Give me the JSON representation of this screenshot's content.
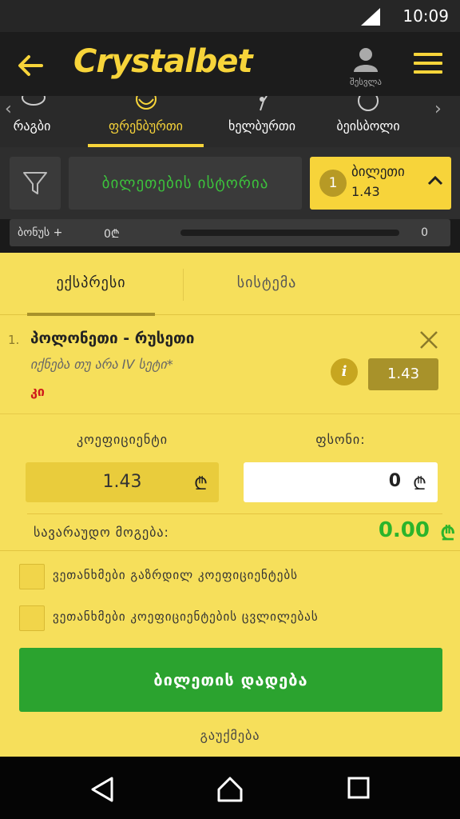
{
  "status_bar": {
    "time": "10:09"
  },
  "header": {
    "logo": "Crystalbet",
    "user_label": "შესვლა"
  },
  "sports_tabs": {
    "items": [
      {
        "label": "რაგბი"
      },
      {
        "label": "ფრენბურთი",
        "active": true
      },
      {
        "label": "ხელბურთი"
      },
      {
        "label": "ბეისბოლი"
      }
    ]
  },
  "toolbar": {
    "history_label": "ბილეთების ისტორია",
    "ticket_count": "1",
    "ticket_label": "ბილეთი",
    "ticket_odds": "1.43"
  },
  "bonus": {
    "label": "ბონუს +",
    "amount": "0₾",
    "count": "0",
    "progress": 0
  },
  "betslip": {
    "tabs": [
      {
        "label": "ექსპრესი",
        "active": true
      },
      {
        "label": "სისტემა"
      }
    ],
    "items": [
      {
        "index": "1.",
        "match": "პოლონეთი - რუსეთი",
        "market": "იქნება თუ არა IV სეტი*",
        "outcome": "კი",
        "odds": "1.43"
      }
    ],
    "coef_label": "კოეფიციენტი",
    "money_label": "ფსონი:",
    "coef_value": "1.43",
    "stake_value": "0",
    "currency": "₾",
    "win_label": "სავარაუდო მოგება:",
    "win_value": "0.00",
    "checkboxes": [
      {
        "label": "ვეთანხმები გაზრდილ კოეფიციენტებს"
      },
      {
        "label": "ვეთანხმები კოეფიციენტების ცვლილებას"
      }
    ],
    "place_label": "ბილეთის დადება",
    "cancel_label": "გაუქმება"
  }
}
